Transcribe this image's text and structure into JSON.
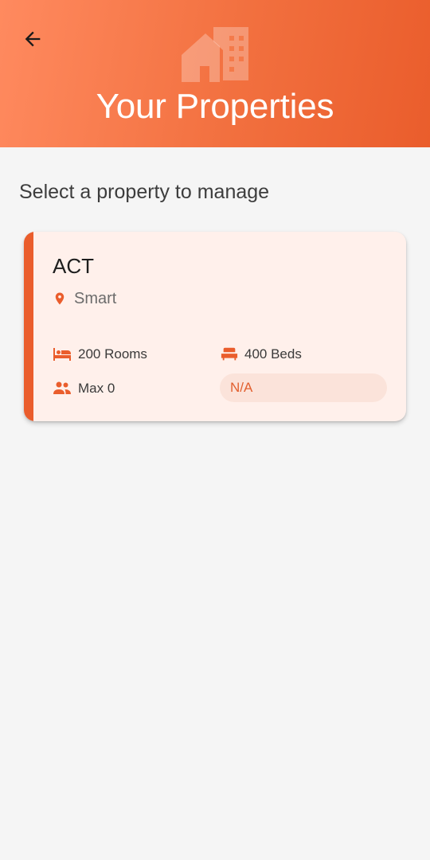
{
  "header": {
    "title": "Your Properties",
    "icon": "building-icon",
    "back_icon": "arrow-back-icon"
  },
  "main": {
    "section_title": "Select a property to manage",
    "properties": [
      {
        "name": "ACT",
        "location": "Smart",
        "rooms": "200 Rooms",
        "beds": "400 Beds",
        "max_guests": "Max 0",
        "status": "N/A"
      }
    ]
  },
  "colors": {
    "accent": "#ea5d2c",
    "header_gradient_start": "#ff8a5f",
    "header_gradient_end": "#ea5d2c",
    "card_background": "#fff0eb",
    "status_badge_background": "#fbe3da"
  }
}
